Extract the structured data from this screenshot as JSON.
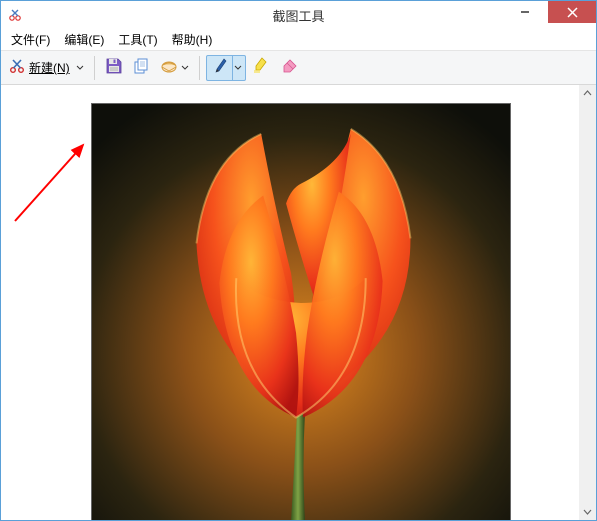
{
  "titlebar": {
    "title": "截图工具"
  },
  "menubar": {
    "file": "文件(F)",
    "edit": "编辑(E)",
    "tools": "工具(T)",
    "help": "帮助(H)"
  },
  "toolbar": {
    "new_label": "新建(N)"
  },
  "icons": {
    "app": "snip-app-icon",
    "minimize": "minimize-icon",
    "close": "close-icon",
    "new": "scissors-icon",
    "save": "save-floppy-icon",
    "copy": "copy-icon",
    "mail": "mail-icon",
    "pen": "pen-icon",
    "highlighter": "highlighter-icon",
    "eraser": "eraser-icon",
    "dropdown": "chevron-down-icon",
    "scroll_up": "scroll-up-icon",
    "scroll_down": "scroll-down-icon"
  },
  "colors": {
    "accent": "#cde6f7",
    "close": "#c75050",
    "arrow": "#ff0000"
  },
  "annotation": {
    "arrow_target": "save-button"
  }
}
